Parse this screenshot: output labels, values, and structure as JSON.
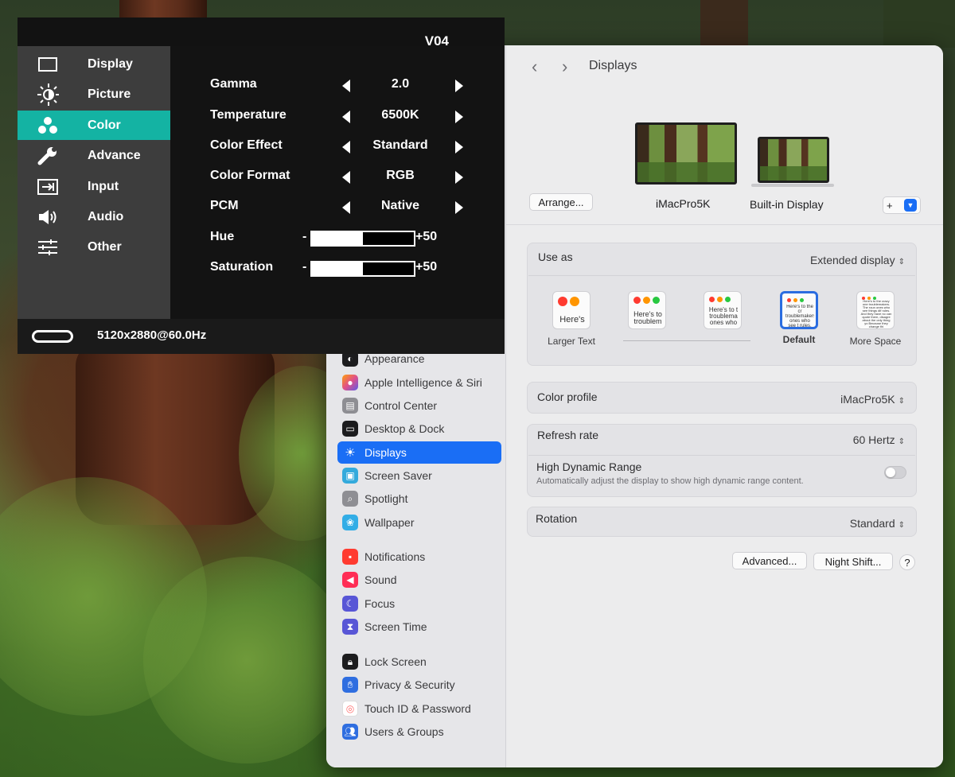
{
  "osd": {
    "version": "V04",
    "menu": [
      {
        "label": "Display",
        "icon": "display-icon"
      },
      {
        "label": "Picture",
        "icon": "brightness-icon"
      },
      {
        "label": "Color",
        "icon": "color-dots-icon",
        "active": true
      },
      {
        "label": "Advance",
        "icon": "wrench-icon"
      },
      {
        "label": "Input",
        "icon": "input-icon"
      },
      {
        "label": "Audio",
        "icon": "speaker-icon"
      },
      {
        "label": "Other",
        "icon": "sliders-icon"
      }
    ],
    "settings": [
      {
        "label": "Gamma",
        "value": "2.0"
      },
      {
        "label": "Temperature",
        "value": "6500K"
      },
      {
        "label": "Color Effect",
        "value": "Standard"
      },
      {
        "label": "Color Format",
        "value": "RGB"
      },
      {
        "label": "PCM",
        "value": "Native"
      }
    ],
    "sliders": [
      {
        "label": "Hue",
        "minus": "-",
        "value_text": "+50",
        "fill": 0.5
      },
      {
        "label": "Saturation",
        "minus": "-",
        "value_text": "+50",
        "fill": 0.5
      }
    ],
    "status": {
      "resolution": "5120x2880@60.0Hz",
      "connector_icon": "usb-c-icon"
    }
  },
  "settings_window": {
    "nav": {
      "back": "‹",
      "forward": "›",
      "title": "Displays"
    },
    "sidebar": {
      "items": [
        {
          "label": "Appearance",
          "icon": "appearance-icon",
          "color": "#1c1c1e"
        },
        {
          "label": "Apple Intelligence & Siri",
          "icon": "siri-icon",
          "color": "#e0508a"
        },
        {
          "label": "Control Center",
          "icon": "control-center-icon",
          "color": "#8e8e93"
        },
        {
          "label": "Desktop & Dock",
          "icon": "dock-icon",
          "color": "#1c1c1e"
        },
        {
          "label": "Displays",
          "icon": "sun-icon",
          "color": "#1a6ef5",
          "selected": true
        },
        {
          "label": "Screen Saver",
          "icon": "screen-saver-icon",
          "color": "#34aadc"
        },
        {
          "label": "Spotlight",
          "icon": "spotlight-icon",
          "color": "#8e8e93"
        },
        {
          "label": "Wallpaper",
          "icon": "wallpaper-icon",
          "color": "#32ade6"
        },
        {
          "label": "Notifications",
          "icon": "bell-icon",
          "color": "#ff3b30"
        },
        {
          "label": "Sound",
          "icon": "sound-icon",
          "color": "#ff2d55"
        },
        {
          "label": "Focus",
          "icon": "moon-icon",
          "color": "#5856d6"
        },
        {
          "label": "Screen Time",
          "icon": "hourglass-icon",
          "color": "#5856d6"
        },
        {
          "label": "Lock Screen",
          "icon": "lock-icon",
          "color": "#1c1c1e"
        },
        {
          "label": "Privacy & Security",
          "icon": "hand-icon",
          "color": "#2f6ee0"
        },
        {
          "label": "Touch ID & Password",
          "icon": "fingerprint-icon",
          "color": "#ff6b6b"
        },
        {
          "label": "Users & Groups",
          "icon": "users-icon",
          "color": "#2f6ee0"
        }
      ]
    },
    "displays": {
      "arrange_label": "Arrange...",
      "primary": "iMacPro5K",
      "secondary": "Built-in Display",
      "add_label": "+"
    },
    "use_as": {
      "label": "Use as",
      "value": "Extended display",
      "options": [
        {
          "caption": "Larger Text",
          "sample": "Here's"
        },
        {
          "caption": "",
          "sample": "Here's to troublem"
        },
        {
          "caption": "",
          "sample": "Here's to t troublema ones who"
        },
        {
          "caption": "Default",
          "sample": "Here's to the cr troublemakers. ones who see t rules. And the",
          "selected": true
        },
        {
          "caption": "More Space",
          "sample": "Here's to the crazy one troublemakers. The roun ones who see things dif rules. And they have no can quote them, disagre about the only thing yo Because they change thi"
        }
      ]
    },
    "color_profile": {
      "label": "Color profile",
      "value": "iMacPro5K"
    },
    "refresh_rate": {
      "label": "Refresh rate",
      "value": "60 Hertz"
    },
    "hdr": {
      "label": "High Dynamic Range",
      "description": "Automatically adjust the display to show high dynamic range content.",
      "enabled": false
    },
    "rotation": {
      "label": "Rotation",
      "value": "Standard"
    },
    "buttons": {
      "advanced": "Advanced...",
      "night_shift": "Night Shift...",
      "help": "?"
    }
  }
}
